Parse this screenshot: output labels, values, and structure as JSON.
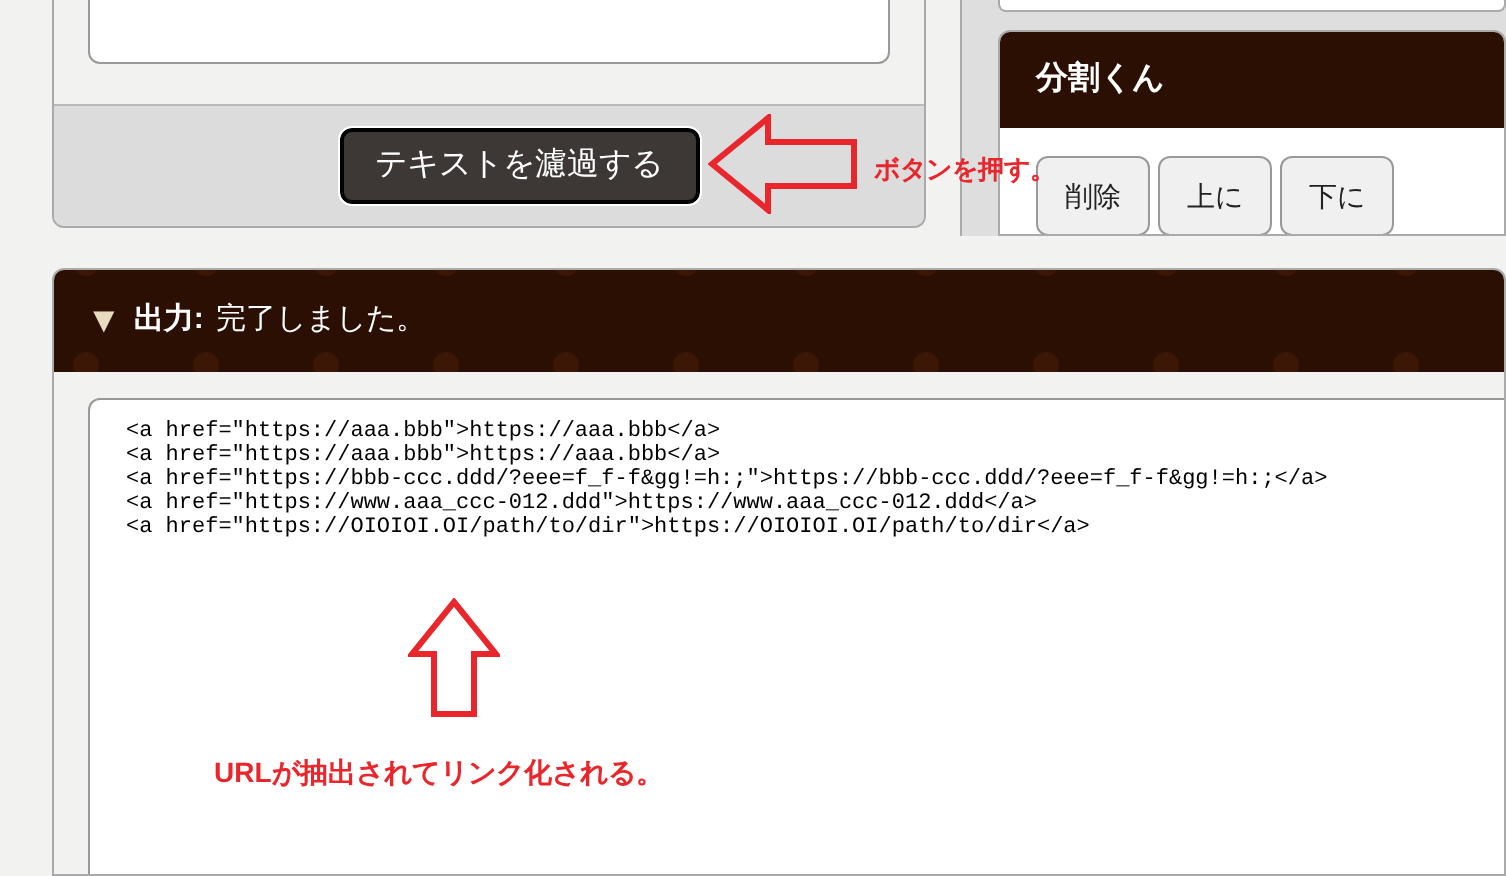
{
  "input_panel": {
    "filter_button": "テキストを濾過する"
  },
  "splitter_panel": {
    "title": "分割くん",
    "buttons": [
      "削除",
      "上に",
      "下に"
    ]
  },
  "output_panel": {
    "toggle": "▼",
    "label": "出力:",
    "status": "完了しました。",
    "lines": [
      "<a href=\"https://aaa.bbb\">https://aaa.bbb</a>",
      "<a href=\"https://aaa.bbb\">https://aaa.bbb</a>",
      "<a href=\"https://bbb-ccc.ddd/?eee=f_f-f&gg!=h:;\">https://bbb-ccc.ddd/?eee=f_f-f&gg!=h:;</a>",
      "<a href=\"https://www.aaa_ccc-012.ddd\">https://www.aaa_ccc-012.ddd</a>",
      "<a href=\"https://OIOIOI.OI/path/to/dir\">https://OIOIOI.OI/path/to/dir</a>"
    ]
  },
  "annotations": [
    {
      "kind": "left",
      "text": "ボタンを押す。"
    },
    {
      "kind": "up",
      "text": "URLが抽出されてリンク化される。"
    }
  ]
}
